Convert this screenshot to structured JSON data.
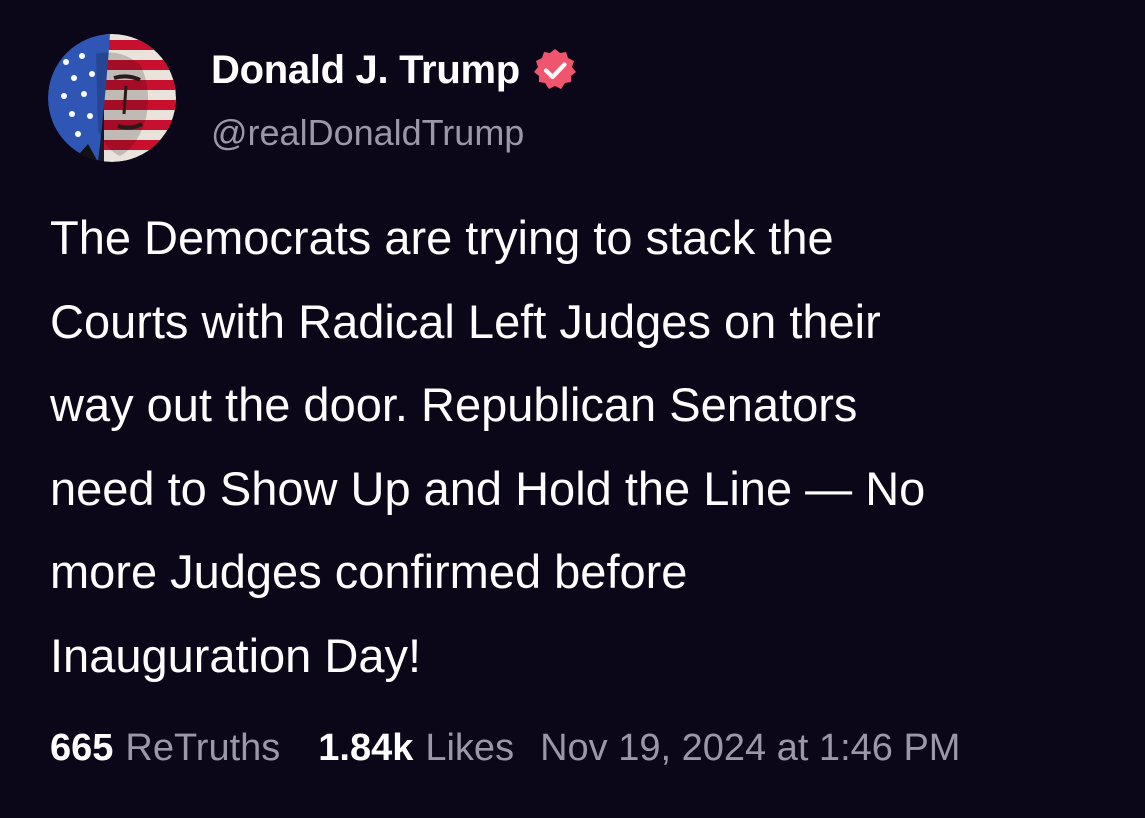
{
  "author": {
    "display_name": "Donald J. Trump",
    "handle": "@realDonaldTrump",
    "avatar_icon": "flag-portrait-avatar",
    "verified_icon": "verified-badge-icon",
    "verified_color": "#f1556e"
  },
  "post": {
    "text": "The Democrats are trying to stack the\nCourts with Radical Left Judges on their\nway out the door. Republican Senators\nneed to Show Up and Hold the Line — No\nmore Judges confirmed before\nInauguration Day!"
  },
  "stats": {
    "retruths_count": "665",
    "retruths_label": "ReTruths",
    "likes_count": "1.84k",
    "likes_label": "Likes",
    "timestamp": "Nov 19, 2024 at 1:46 PM"
  },
  "colors": {
    "background": "#0b0718",
    "text_primary": "#ffffff",
    "text_secondary": "#9b97a8"
  }
}
